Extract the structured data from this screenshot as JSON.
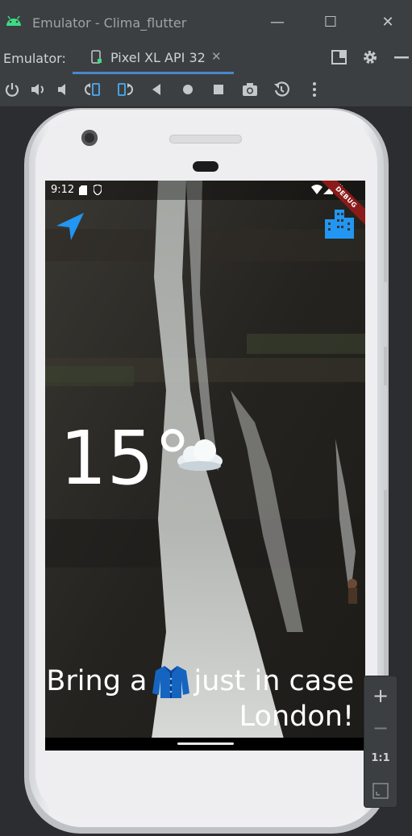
{
  "window": {
    "title": "Emulator - Clima_flutter",
    "controls": [
      "minimize-icon",
      "maximize-icon",
      "close-icon"
    ]
  },
  "tabbar": {
    "label": "Emulator:",
    "tab_name": "Pixel XL API 32",
    "tab_close": "✕",
    "right_icons": [
      "window-layout-icon",
      "gear-icon",
      "minimize-panel-icon"
    ]
  },
  "toolbar": {
    "icons": [
      "power-icon",
      "volume-up-icon",
      "volume-down-icon",
      "rotate-left-icon",
      "rotate-right-icon",
      "back-icon",
      "home-icon",
      "overview-icon",
      "camera-icon",
      "snapshot-icon",
      "more-icon"
    ]
  },
  "app": {
    "status_time": "9:12",
    "debug_banner": "DEBUG",
    "temperature": "15°",
    "weather_icon": "cloud-icon",
    "message_prefix": "Bring a",
    "message_icon": "jacket-icon",
    "message_suffix": "just in case",
    "city_line": "London!",
    "accent_color": "#2196f3"
  },
  "zoom_panel": {
    "zoom_in": "+",
    "zoom_out": "−",
    "one_to_one": "1:1",
    "fit_icon": "fit-screen-icon"
  }
}
